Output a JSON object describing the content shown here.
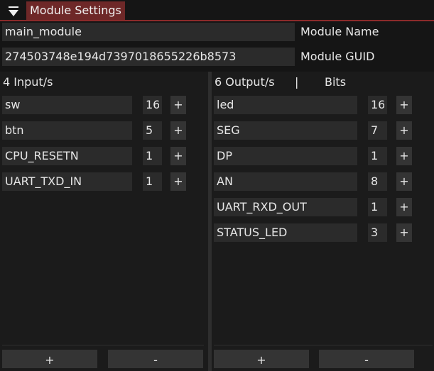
{
  "header": {
    "title": "Module Settings"
  },
  "module": {
    "name_value": "main_module",
    "name_label": "Module Name",
    "guid_value": "274503748e194d7397018655226b8573",
    "guid_label": "Module GUID"
  },
  "inputs": {
    "heading": "4 Input/s",
    "rows": [
      {
        "name": "sw",
        "bits": "16",
        "add": "+"
      },
      {
        "name": "btn",
        "bits": "5",
        "add": "+"
      },
      {
        "name": "CPU_RESETN",
        "bits": "1",
        "add": "+"
      },
      {
        "name": "UART_TXD_IN",
        "bits": "1",
        "add": "+"
      }
    ],
    "add_label": "+",
    "remove_label": "-"
  },
  "outputs": {
    "heading": "6 Output/s",
    "heading_sep": "|",
    "bits_heading": "Bits",
    "rows": [
      {
        "name": "led",
        "bits": "16",
        "add": "+"
      },
      {
        "name": "SEG",
        "bits": "7",
        "add": "+"
      },
      {
        "name": "DP",
        "bits": "1",
        "add": "+"
      },
      {
        "name": "AN",
        "bits": "8",
        "add": "+"
      },
      {
        "name": "UART_RXD_OUT",
        "bits": "1",
        "add": "+"
      },
      {
        "name": "STATUS_LED",
        "bits": "3",
        "add": "+"
      }
    ],
    "add_label": "+",
    "remove_label": "-"
  }
}
